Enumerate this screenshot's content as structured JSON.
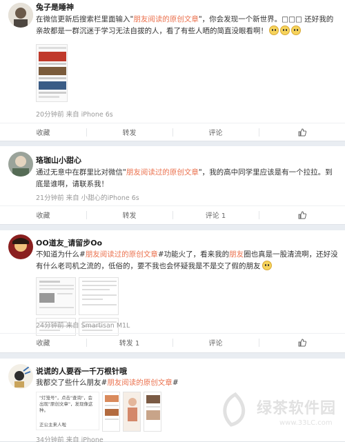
{
  "posts": [
    {
      "username": "兔子是睡神",
      "text_pre": "在微信更新后搜索栏里面输入\"",
      "text_hl": "朋友阅读的原创文章",
      "text_post": "\"，你会发现一个新世界。□□□  还好我的亲故都是一群沉迷于学习无法自拔的人，看了有些人晒的简直没眼看啊！",
      "meta": "20分钟前 来自 iPhone 6s",
      "actions": {
        "favorite": "收藏",
        "repost": "转发",
        "comment": "评论"
      }
    },
    {
      "username": "珞珈山小甜心",
      "text_pre": "通过无意中在群里比对微信\"",
      "text_hl": "朋友阅读过的原创文章",
      "text_post": "\"，我的高中同学里应该是有一个拉拉。到底是谁啊，请联系我！",
      "meta": "21分钟前 来自 小甜心的iPhone 6s",
      "actions": {
        "favorite": "收藏",
        "repost": "转发",
        "comment": "评论 1"
      }
    },
    {
      "username": "OO道友_请留步Oo",
      "text_pre": "不知道为什么#",
      "text_hl": "朋友阅读过的原创文章",
      "text_post": "#功能火了，看来我的",
      "text_hl2": "朋友",
      "text_post2": "圈也真是一股清流啊，还好没有什么老司机之流的，低俗的，要不我也会怀疑我是不是交了假的朋友",
      "meta": "24分钟前 来自 Smartisan M1L",
      "actions": {
        "favorite": "收藏",
        "repost": "转发 1",
        "comment": "评论"
      }
    },
    {
      "username": "说谎的人要吞一千万根针哦",
      "text_pre": "我都交了些什么朋友#",
      "text_hl": "朋友阅读的原创文章",
      "text_post": "#",
      "meta": "34分钟前 来自 iPhone",
      "thumb_text": "\"灯笼号\"，点击\"查询\"，会出现\"原创文章\"，发现像这种。",
      "thumb_text2": "正公主来人啦"
    }
  ],
  "watermark": {
    "text": "绿茶软件园",
    "url": "www.33LC.com"
  }
}
